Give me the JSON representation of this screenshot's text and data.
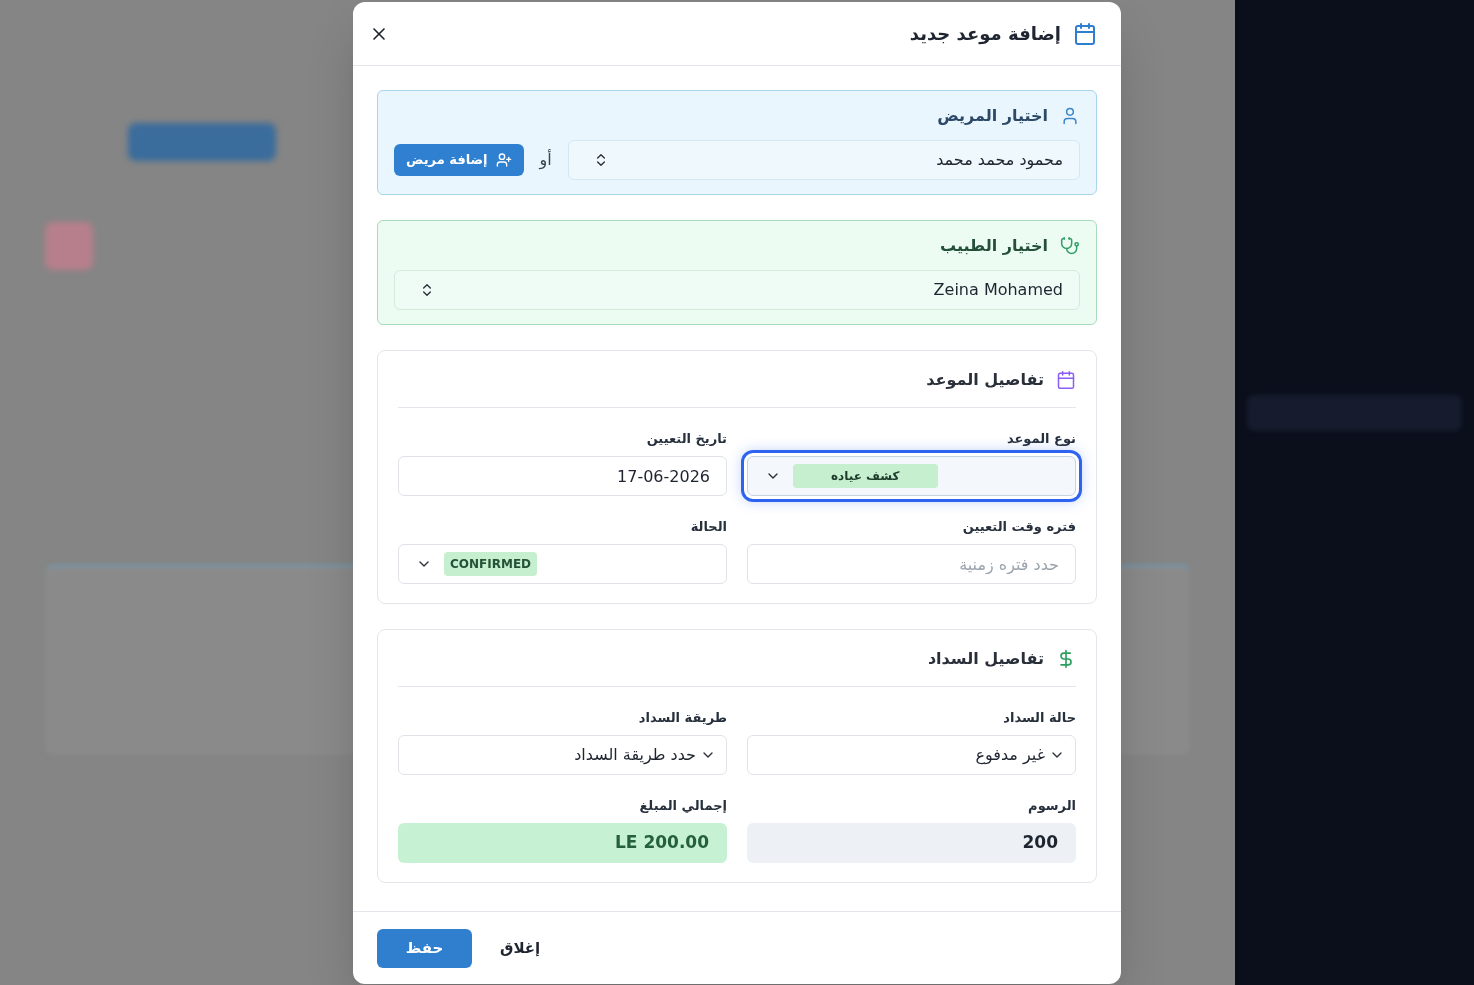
{
  "dialog": {
    "title": "إضافة موعد جديد",
    "patient_section": {
      "title": "اختيار المريض",
      "select": {
        "value": "محمود محمد محمد"
      },
      "or_text": "أو",
      "add_button": "إضافة مريض"
    },
    "doctor_section": {
      "title": "اختيار الطبيب",
      "select": {
        "value": "Zeina Mohamed"
      }
    },
    "appointment_section": {
      "title": "تفاصيل الموعد",
      "fields": [
        {
          "kind": "tag-select",
          "label": "نوع الموعد",
          "value": "كشف عياده",
          "focused": true
        },
        {
          "kind": "text",
          "label": "تاريخ التعيين",
          "value": "17-06-2026",
          "focused": false
        },
        {
          "kind": "text",
          "label": "فتره وقت التعيين",
          "placeholder": "حدد فتره زمنية",
          "focused": false
        },
        {
          "kind": "status-select",
          "label": "الحالة",
          "value": "CONFIRMED",
          "focused": false
        }
      ]
    },
    "payment_section": {
      "title": "تفاصيل السداد",
      "fields": [
        {
          "kind": "select",
          "label": "حالة السداد",
          "value": "غير مدفوع"
        },
        {
          "kind": "select",
          "label": "طريقة السداد",
          "value": "حدد طريقة السداد"
        },
        {
          "kind": "readonly",
          "label": "الرسوم",
          "value": "200"
        },
        {
          "kind": "total",
          "label": "إجمالي المبلغ",
          "value": "LE 200.00"
        }
      ]
    },
    "footer": {
      "buttons": [
        {
          "kind": "secondary",
          "label": "إغلاق"
        },
        {
          "kind": "primary",
          "label": "حفظ"
        }
      ]
    }
  }
}
